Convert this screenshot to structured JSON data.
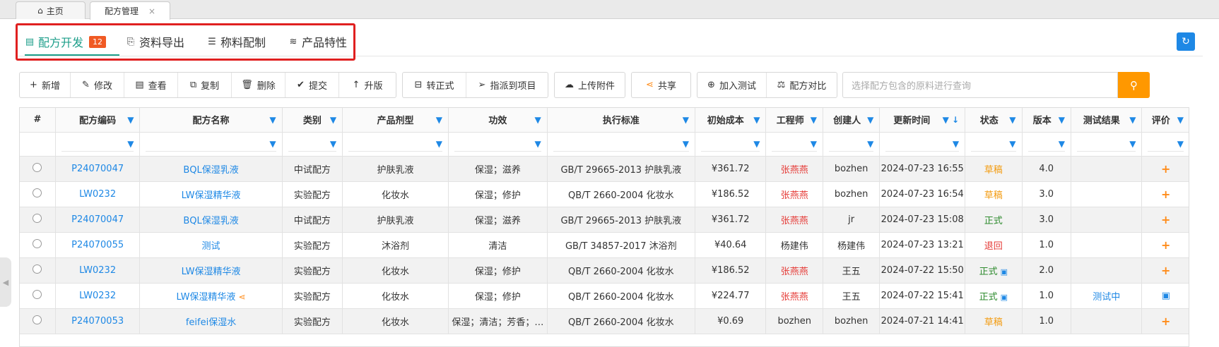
{
  "tabs": [
    {
      "label": "主页",
      "icon": "home-icon"
    },
    {
      "label": "配方管理",
      "close": "×"
    }
  ],
  "subnav": [
    {
      "label": "配方开发",
      "badge": "12",
      "icon": "book-icon"
    },
    {
      "label": "资料导出",
      "icon": "file-export-icon"
    },
    {
      "label": "称料配制",
      "icon": "clipboard-icon"
    },
    {
      "label": "产品特性",
      "icon": "layers-icon"
    }
  ],
  "toolbar": {
    "group1": [
      "新增",
      "修改",
      "查看",
      "复制",
      "删除",
      "提交",
      "升版"
    ],
    "group2": [
      "转正式",
      "指派到项目"
    ],
    "group3": [
      "上传附件"
    ],
    "group4": [
      "共享"
    ],
    "group5": [
      "加入测试",
      "配方对比"
    ]
  },
  "search": {
    "placeholder": "选择配方包含的原料进行查询"
  },
  "columns": [
    "#",
    "配方编码",
    "配方名称",
    "类别",
    "产品剂型",
    "功效",
    "执行标准",
    "初始成本",
    "工程师",
    "创建人",
    "更新时间",
    "状态",
    "版本",
    "测试结果",
    "评价"
  ],
  "rows": [
    {
      "code": "P24070047",
      "name": "BQL保湿乳液",
      "category": "中试配方",
      "form": "护肤乳液",
      "effect": "保湿；滋养",
      "standard": "GB/T 29665-2013 护肤乳液",
      "cost": "¥361.72",
      "engineer": "张燕燕",
      "creator": "bozhen",
      "updated": "2024-07-23 16:55",
      "status": "草稿",
      "version": "4.0",
      "test": "",
      "rating": "+"
    },
    {
      "code": "LW0232",
      "name": "LW保湿精华液",
      "category": "实验配方",
      "form": "化妆水",
      "effect": "保湿；修护",
      "standard": "QB/T 2660-2004 化妆水",
      "cost": "¥186.52",
      "engineer": "张燕燕",
      "creator": "bozhen",
      "updated": "2024-07-23 16:54",
      "status": "草稿",
      "version": "3.0",
      "test": "",
      "rating": "+"
    },
    {
      "code": "P24070047",
      "name": "BQL保湿乳液",
      "category": "中试配方",
      "form": "护肤乳液",
      "effect": "保湿；滋养",
      "standard": "GB/T 29665-2013 护肤乳液",
      "cost": "¥361.72",
      "engineer": "张燕燕",
      "creator": "jr",
      "updated": "2024-07-23 15:08",
      "status": "正式",
      "version": "3.0",
      "test": "",
      "rating": "+"
    },
    {
      "code": "P24070055",
      "name": "测试",
      "category": "实验配方",
      "form": "沐浴剂",
      "effect": "清洁",
      "standard": "GB/T 34857-2017 沐浴剂",
      "cost": "¥40.64",
      "engineer": "杨建伟",
      "creator": "杨建伟",
      "updated": "2024-07-23 13:21",
      "status": "退回",
      "version": "1.0",
      "test": "",
      "rating": "+"
    },
    {
      "code": "LW0232",
      "name": "LW保湿精华液",
      "category": "实验配方",
      "form": "化妆水",
      "effect": "保湿；修护",
      "standard": "QB/T 2660-2004 化妆水",
      "cost": "¥186.52",
      "engineer": "张燕燕",
      "creator": "王五",
      "updated": "2024-07-22 15:50",
      "status": "正式",
      "version": "2.0",
      "test": "",
      "rating": "+"
    },
    {
      "code": "LW0232",
      "name": "LW保湿精华液",
      "category": "实验配方",
      "form": "化妆水",
      "effect": "保湿；修护",
      "standard": "QB/T 2660-2004 化妆水",
      "cost": "¥224.77",
      "engineer": "张燕燕",
      "creator": "王五",
      "updated": "2024-07-22 15:41",
      "status": "正式",
      "version": "1.0",
      "test": "测试中",
      "rating": "▣"
    },
    {
      "code": "P24070053",
      "name": "feifei保湿水",
      "category": "实验配方",
      "form": "化妆水",
      "effect": "保湿；清洁；芳香；…",
      "standard": "QB/T 2660-2004 化妆水",
      "cost": "¥0.69",
      "engineer": "bozhen",
      "creator": "bozhen",
      "updated": "2024-07-21 14:41",
      "status": "草稿",
      "version": "1.0",
      "test": "",
      "rating": "+"
    }
  ]
}
